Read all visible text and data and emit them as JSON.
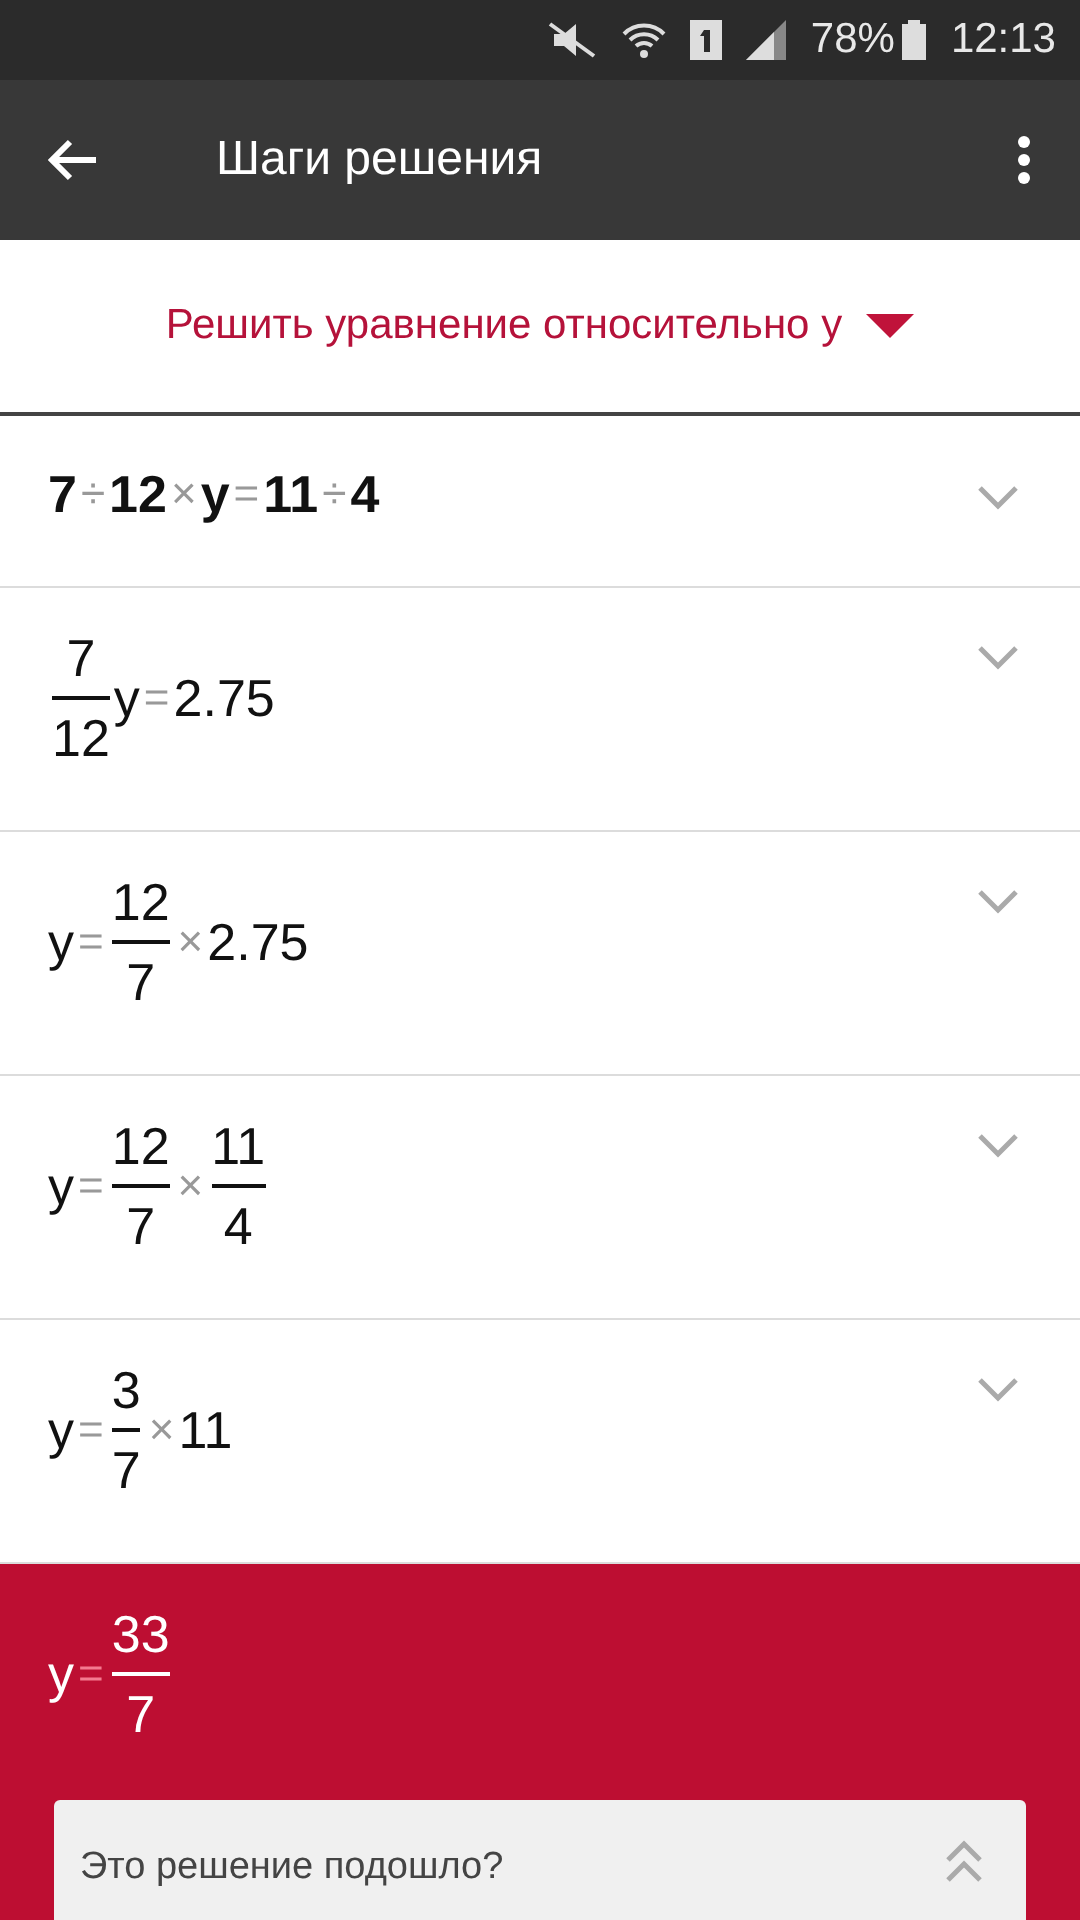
{
  "status_bar": {
    "battery": "78%",
    "time": "12:13"
  },
  "app_bar": {
    "title": "Шаги решения"
  },
  "mode_selector": {
    "label": "Решить уравнение относительно y"
  },
  "steps": [
    {
      "kind": "step",
      "bold": true,
      "tokens": [
        {
          "kind": "text",
          "text": "7"
        },
        {
          "kind": "op",
          "text": "÷"
        },
        {
          "kind": "text",
          "text": "12"
        },
        {
          "kind": "op",
          "text": "×"
        },
        {
          "kind": "text",
          "text": "y"
        },
        {
          "kind": "op",
          "text": "="
        },
        {
          "kind": "text",
          "text": "11"
        },
        {
          "kind": "op",
          "text": "÷"
        },
        {
          "kind": "text",
          "text": "4"
        }
      ]
    },
    {
      "kind": "step",
      "bold": false,
      "tokens": [
        {
          "kind": "frac",
          "num": "7",
          "den": "12"
        },
        {
          "kind": "text",
          "text": "y"
        },
        {
          "kind": "op",
          "text": "="
        },
        {
          "kind": "text",
          "text": "2.75"
        }
      ]
    },
    {
      "kind": "step",
      "bold": false,
      "tokens": [
        {
          "kind": "text",
          "text": "y"
        },
        {
          "kind": "op",
          "text": "="
        },
        {
          "kind": "frac",
          "num": "12",
          "den": "7"
        },
        {
          "kind": "op",
          "text": "×"
        },
        {
          "kind": "text",
          "text": "2.75"
        }
      ]
    },
    {
      "kind": "step",
      "bold": false,
      "tokens": [
        {
          "kind": "text",
          "text": "y"
        },
        {
          "kind": "op",
          "text": "="
        },
        {
          "kind": "frac",
          "num": "12",
          "den": "7"
        },
        {
          "kind": "op",
          "text": "×"
        },
        {
          "kind": "frac",
          "num": "11",
          "den": "4"
        }
      ]
    },
    {
      "kind": "step",
      "bold": false,
      "tokens": [
        {
          "kind": "text",
          "text": "y"
        },
        {
          "kind": "op",
          "text": "="
        },
        {
          "kind": "frac",
          "num": "3",
          "den": "7"
        },
        {
          "kind": "op",
          "text": "×"
        },
        {
          "kind": "text",
          "text": "11"
        }
      ]
    },
    {
      "kind": "answer",
      "bold": false,
      "tokens": [
        {
          "kind": "text",
          "text": "y"
        },
        {
          "kind": "op",
          "text": "="
        },
        {
          "kind": "frac",
          "num": "33",
          "den": "7"
        }
      ]
    }
  ],
  "feedback": {
    "question": "Это решение подошло?"
  }
}
